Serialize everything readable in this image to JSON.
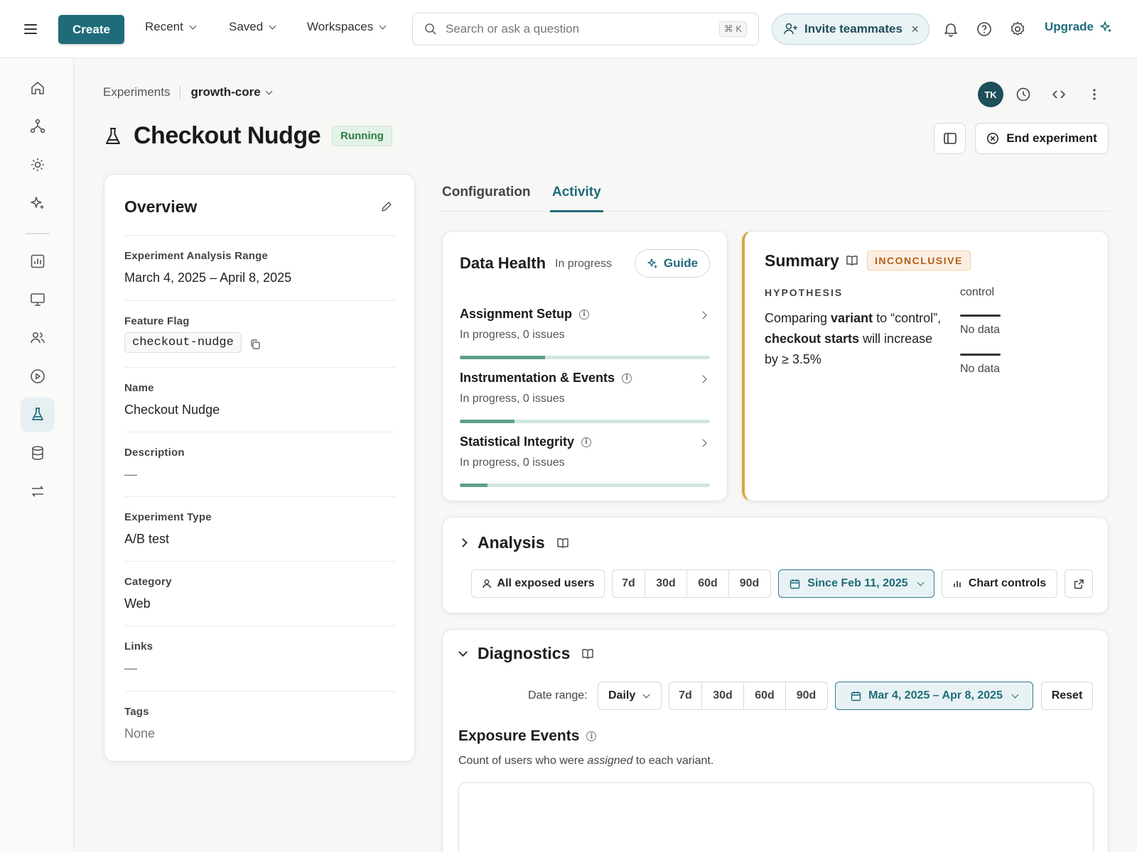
{
  "topbar": {
    "create_label": "Create",
    "menus": [
      "Recent",
      "Saved",
      "Workspaces"
    ],
    "search_placeholder": "Search or ask a question",
    "search_shortcut": "⌘ K",
    "invite_label": "Invite teammates",
    "upgrade_label": "Upgrade"
  },
  "breadcrumb": {
    "parent": "Experiments",
    "current": "growth-core"
  },
  "header": {
    "avatar_initials": "TK",
    "title": "Checkout Nudge",
    "status": "Running",
    "end_label": "End experiment"
  },
  "overview": {
    "title": "Overview",
    "fields": [
      {
        "label": "Experiment Analysis Range",
        "value": "March 4, 2025 – April 8, 2025"
      },
      {
        "label": "Feature Flag",
        "value": "checkout-nudge"
      },
      {
        "label": "Name",
        "value": "Checkout Nudge"
      },
      {
        "label": "Description",
        "value": "—"
      },
      {
        "label": "Experiment Type",
        "value": "A/B test"
      },
      {
        "label": "Category",
        "value": "Web"
      },
      {
        "label": "Links",
        "value": "—"
      },
      {
        "label": "Tags",
        "value": "None"
      }
    ]
  },
  "tabs": [
    "Configuration",
    "Activity"
  ],
  "active_tab": "Activity",
  "data_health": {
    "title": "Data Health",
    "status": "In progress",
    "guide_label": "Guide",
    "rows": [
      {
        "title": "Assignment Setup",
        "sub": "In progress, 0 issues",
        "progress": 0.34
      },
      {
        "title": "Instrumentation & Events",
        "sub": "In progress, 0 issues",
        "progress": 0.22
      },
      {
        "title": "Statistical Integrity",
        "sub": "In progress, 0 issues",
        "progress": 0.11
      }
    ]
  },
  "summary": {
    "title": "Summary",
    "badge": "INCONCLUSIVE",
    "hypothesis_label": "HYPOTHESIS",
    "hyp_1": "Comparing ",
    "hyp_variant": "variant",
    "hyp_2": " to “control”, ",
    "hyp_metric": "checkout starts",
    "hyp_3": " will increase by ≥ 3.5%",
    "control_label": "control",
    "no_data_1": "No data",
    "no_data_2": "No data"
  },
  "analysis": {
    "title": "Analysis",
    "users_label": "All exposed users",
    "ranges": [
      "7d",
      "30d",
      "60d",
      "90d"
    ],
    "since_label": "Since Feb 11, 2025",
    "chart_controls_label": "Chart controls"
  },
  "diagnostics": {
    "title": "Diagnostics",
    "date_range_label": "Date range:",
    "granularity": "Daily",
    "ranges": [
      "7d",
      "30d",
      "60d",
      "90d"
    ],
    "date_label": "Mar 4, 2025 – Apr 8, 2025",
    "reset_label": "Reset",
    "exposure_title": "Exposure Events",
    "exposure_desc_1": "Count of users who were ",
    "exposure_desc_em": "assigned",
    "exposure_desc_2": " to each variant."
  },
  "colors": {
    "accent": "#1f6b7a",
    "running": "#2e7a44",
    "inconclusive": "#b55e17",
    "progress": "#5e9f8c"
  }
}
